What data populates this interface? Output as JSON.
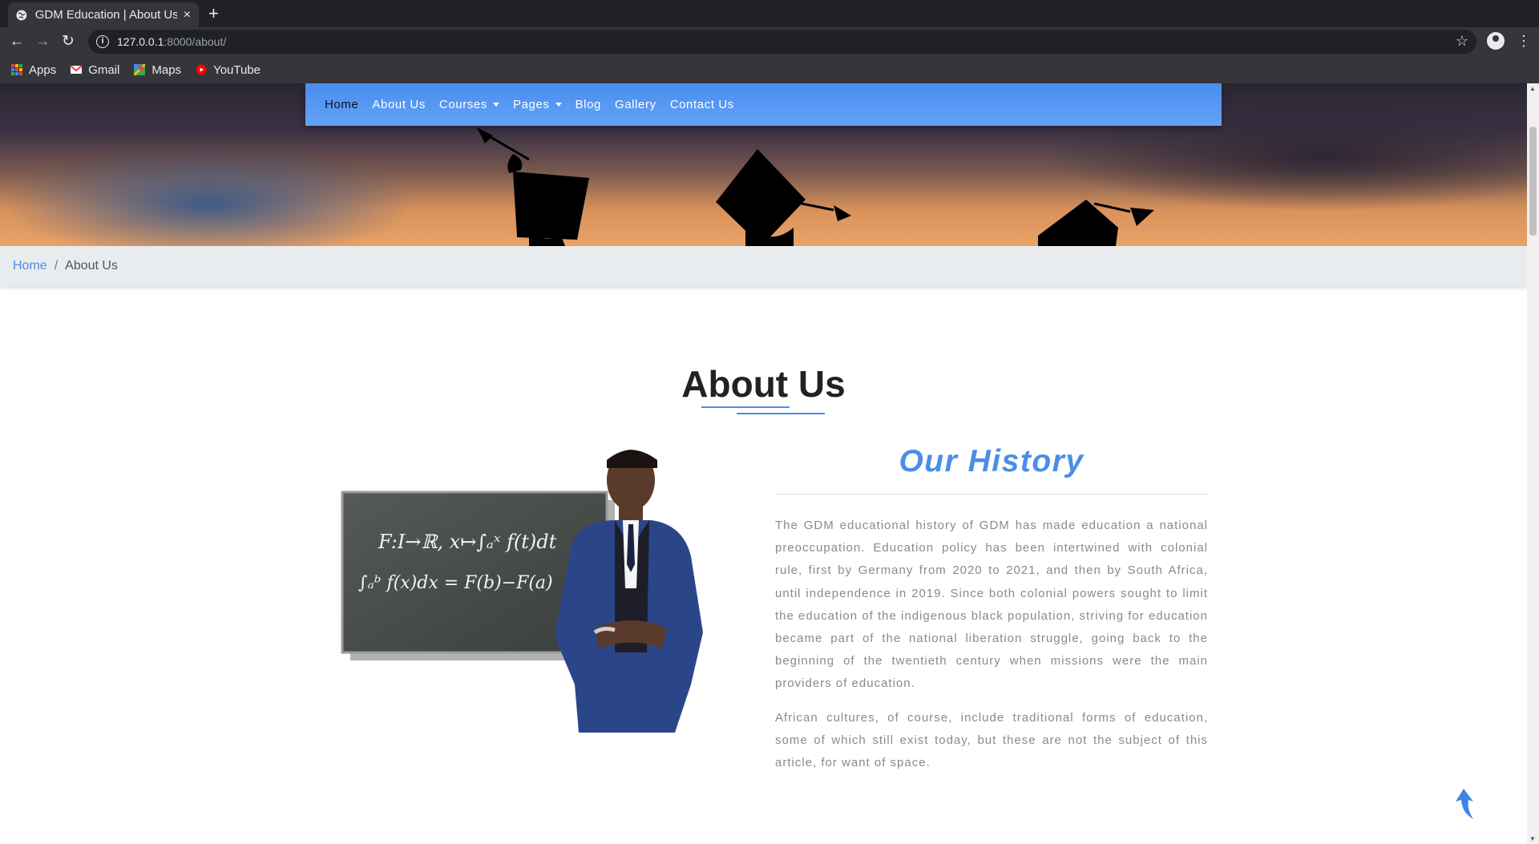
{
  "browser": {
    "tab_title": "GDM Education | About Us",
    "tab_close": "×",
    "new_tab": "+",
    "url_host": "127.0.0.1",
    "url_rest": ":8000/about/",
    "bookmarks": [
      {
        "label": "Apps",
        "icon": "apps-grid-icon"
      },
      {
        "label": "Gmail",
        "icon": "gmail-icon"
      },
      {
        "label": "Maps",
        "icon": "maps-icon"
      },
      {
        "label": "YouTube",
        "icon": "youtube-icon"
      }
    ]
  },
  "nav": {
    "items": [
      {
        "label": "Home",
        "active": true
      },
      {
        "label": "About Us"
      },
      {
        "label": "Courses",
        "dropdown": true
      },
      {
        "label": "Pages",
        "dropdown": true
      },
      {
        "label": "Blog"
      },
      {
        "label": "Gallery"
      },
      {
        "label": "Contact Us"
      }
    ]
  },
  "breadcrumb": {
    "home": "Home",
    "separator": "/",
    "current": "About Us"
  },
  "about": {
    "title_light": "About",
    "title_bold": "Us",
    "image_formulas": {
      "line1": "F:I→ℝ, x↦∫ₐˣ f(t)dt",
      "line2": "∫ₐᵇ f(x)dx = F(b)−F(a)"
    },
    "history_title": "Our History",
    "paragraph1": "The GDM educational history of GDM has made education a national preoccupation. Education policy has been intertwined with colonial rule, first by Germany from 2020 to 2021, and then by South Africa, until independence in 2019. Since both colonial powers sought to limit the education of the indigenous black population, striving for education became part of the national liberation struggle, going back to the beginning of the twentieth century when missions were the main providers of education.",
    "paragraph2": "African cultures, of course, include traditional forms of education, some of which still exist today, but these are not the subject of this article, for want of space."
  },
  "colors": {
    "accent": "#4a8ee5",
    "navbar": "#5a9af2",
    "breadcrumb_bg": "#e9ecef"
  }
}
